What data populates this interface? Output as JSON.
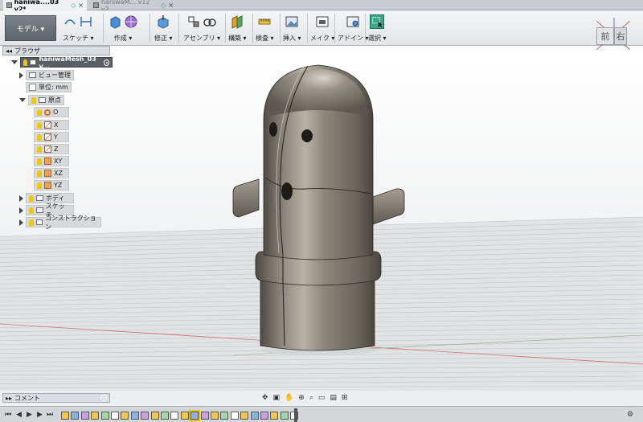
{
  "tabs": [
    {
      "title": "haniwa....03 v2*",
      "status": "◇",
      "close": "×"
    },
    {
      "title": "haniwaM....v12 v2",
      "status": "◇",
      "close": "×"
    }
  ],
  "toolbar": {
    "workspace": "モデル ▾",
    "groups": [
      {
        "label": "スケッチ ▾"
      },
      {
        "label": "作成 ▾"
      },
      {
        "label": "修正 ▾"
      },
      {
        "label": "アセンブリ ▾"
      },
      {
        "label": "構築 ▾"
      },
      {
        "label": "検査 ▾"
      },
      {
        "label": "挿入 ▾"
      },
      {
        "label": "メイク ▾"
      },
      {
        "label": "アドイン ▾"
      },
      {
        "label": "選択 ▾"
      }
    ]
  },
  "viewcube": {
    "front": "前",
    "right": "右"
  },
  "browser": {
    "title": "ブラウザ",
    "root": "haniwaMesh_03 v...",
    "items": [
      {
        "label": "ビュー管理"
      },
      {
        "label": "単位: mm"
      },
      {
        "label": "原点"
      },
      {
        "label": "O"
      },
      {
        "label": "X"
      },
      {
        "label": "Y"
      },
      {
        "label": "Z"
      },
      {
        "label": "XY"
      },
      {
        "label": "XZ"
      },
      {
        "label": "YZ"
      },
      {
        "label": "ボディ"
      },
      {
        "label": "スケッチ"
      },
      {
        "label": "コンストラクション"
      }
    ]
  },
  "comment": {
    "title": "コメント"
  },
  "colors": {
    "accent": "#3aa88a",
    "model_metal": "#6e6a62",
    "grid_line": "#bfc2c5",
    "axis_red": "#d07070",
    "axis_green": "#7ab07a"
  }
}
